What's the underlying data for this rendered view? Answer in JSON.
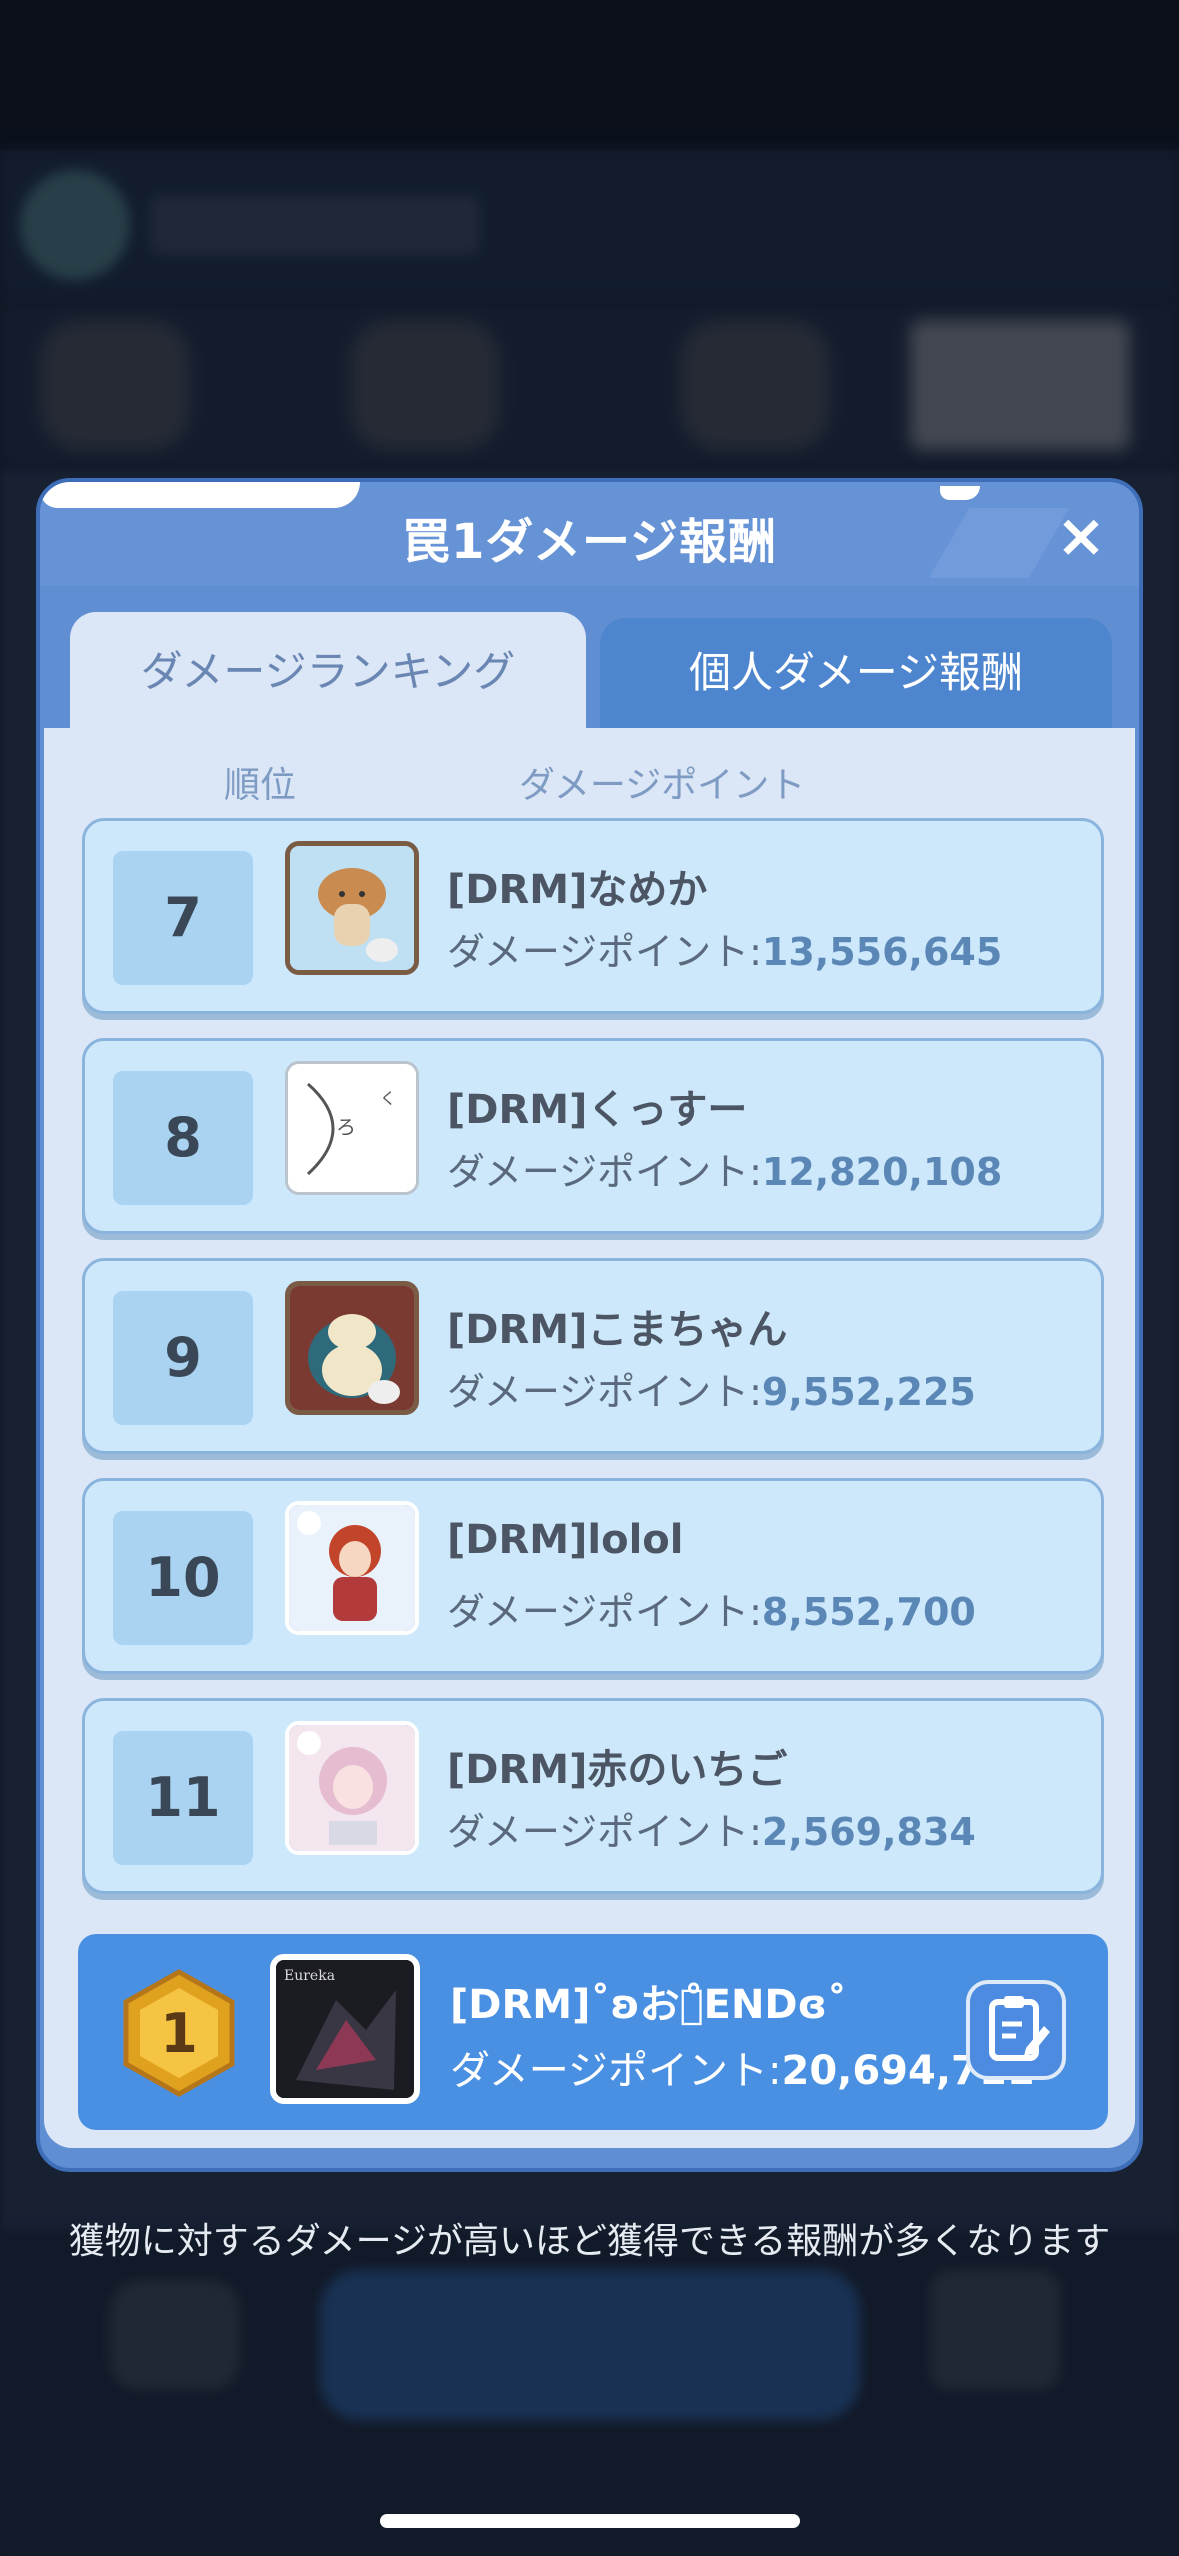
{
  "modal": {
    "title": "罠1ダメージ報酬",
    "close_icon": "×",
    "tabs": [
      {
        "label": "ダメージランキング",
        "active": true
      },
      {
        "label": "個人ダメージ報酬",
        "active": false
      }
    ],
    "columns": {
      "rank": "順位",
      "damage": "ダメージポイント"
    }
  },
  "ranking": [
    {
      "rank": "7",
      "name": "[DRM]なめか",
      "damage_label": "ダメージポイント:",
      "damage": "13,556,645",
      "avatar": "mushroom-avatar"
    },
    {
      "rank": "8",
      "name": "[DRM]くっすー",
      "damage_label": "ダメージポイント:",
      "damage": "12,820,108",
      "avatar": "sketch-avatar"
    },
    {
      "rank": "9",
      "name": "[DRM]こまちゃん",
      "damage_label": "ダメージポイント:",
      "damage": "9,552,225",
      "avatar": "snorlax-avatar"
    },
    {
      "rank": "10",
      "name": "[DRM]lolol",
      "damage_label": "ダメージポイント:",
      "damage": "8,552,700",
      "avatar": "redhead-avatar"
    },
    {
      "rank": "11",
      "name": "[DRM]赤のいちご",
      "damage_label": "ダメージポイント:",
      "damage": "2,569,834",
      "avatar": "pinkhair-avatar"
    }
  ],
  "me": {
    "rank": "1",
    "name": "[DRM]˚ʚおじ̊ENDɞ˚",
    "damage_label": "ダメージポイント:",
    "damage": "20,694,711",
    "avatar_text": "Eureka"
  },
  "footer_note": "獲物に対するダメージが高いほど獲得できる報酬が多くなります",
  "colors": {
    "accent": "#4a90e2",
    "panel": "#dbe6f6",
    "row": "#cde8fb"
  }
}
